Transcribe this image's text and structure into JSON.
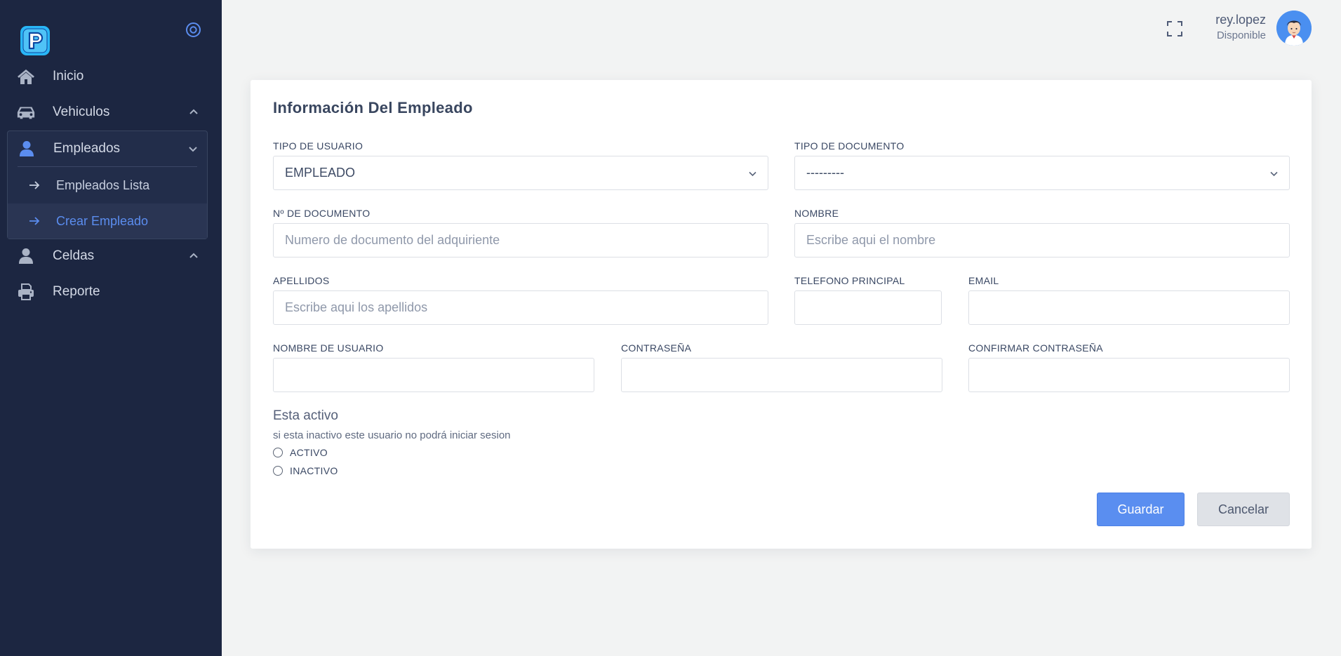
{
  "colors": {
    "sidebar_bg": "#1c2641",
    "accent": "#5a8ef0",
    "page_bg": "#f2f3f3"
  },
  "sidebar": {
    "items": [
      {
        "label": "Inicio",
        "icon": "home-icon"
      },
      {
        "label": "Vehiculos",
        "icon": "car-icon"
      },
      {
        "label": "Empleados",
        "icon": "user-icon",
        "children": [
          {
            "label": "Empleados Lista"
          },
          {
            "label": "Crear Empleado",
            "active": true
          }
        ]
      },
      {
        "label": "Celdas",
        "icon": "user-icon"
      },
      {
        "label": "Reporte",
        "icon": "printer-icon"
      }
    ]
  },
  "header": {
    "user_name": "rey.lopez",
    "user_status": "Disponible"
  },
  "form": {
    "title": "Información Del Empleado",
    "tipo_usuario": {
      "label": "TIPO DE USUARIO",
      "value": "EMPLEADO"
    },
    "tipo_documento": {
      "label": "TIPO DE DOCUMENTO",
      "value": "---------"
    },
    "num_documento": {
      "label": "Nº DE DOCUMENTO",
      "placeholder": "Numero de documento del adquiriente",
      "value": ""
    },
    "nombre": {
      "label": "NOMBRE",
      "placeholder": "Escribe aqui el nombre",
      "value": ""
    },
    "apellidos": {
      "label": "APELLIDOS",
      "placeholder": "Escribe aqui los apellidos",
      "value": ""
    },
    "telefono": {
      "label": "TELEFONO PRINCIPAL",
      "value": ""
    },
    "email": {
      "label": "EMAIL",
      "value": ""
    },
    "usuario": {
      "label": "NOMBRE DE USUARIO",
      "value": ""
    },
    "password": {
      "label": "CONTRASEÑA",
      "value": ""
    },
    "password_confirm": {
      "label": "CONFIRMAR CONTRASEÑA",
      "value": ""
    },
    "active_section": {
      "title": "Esta activo",
      "help": "si esta inactivo este usuario no podrá iniciar sesion",
      "options": [
        "ACTIVO",
        "INACTIVO"
      ]
    },
    "save_label": "Guardar",
    "cancel_label": "Cancelar"
  }
}
